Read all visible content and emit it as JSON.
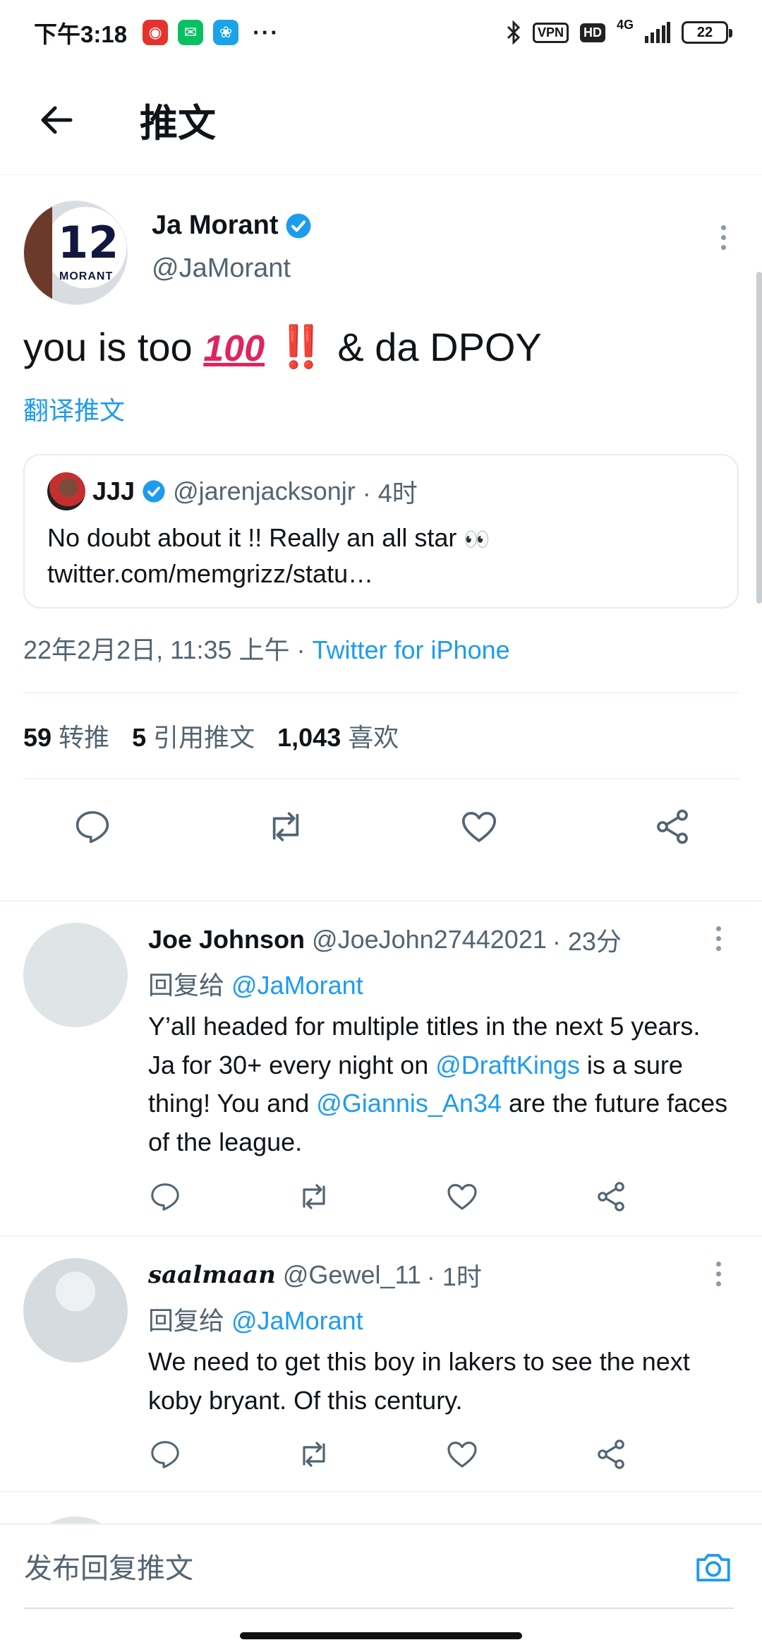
{
  "status_bar": {
    "time": "下午3:18",
    "dots": "···",
    "vpn": "VPN",
    "hd": "HD",
    "network": "4G",
    "battery": "22"
  },
  "header": {
    "title": "推文"
  },
  "main_tweet": {
    "author_name": "Ja Morant",
    "author_handle": "@JaMorant",
    "avatar_number": "12",
    "avatar_jersey_name": "MORANT",
    "text_before": "you is too ",
    "emoji_100": "100",
    "emoji_bang": "‼️",
    "text_after": " & da DPOY",
    "translate": "翻译推文",
    "quote": {
      "name": "JJJ",
      "handle": "@jarenjacksonjr",
      "time": "· 4时",
      "text": "No doubt about it !! Really an all star ",
      "eyes": "👀",
      "link": "twitter.com/memgrizz/statu…"
    },
    "date": "22年2月2日, 11:35 上午 · ",
    "client": "Twitter for iPhone",
    "stats": {
      "retweets": "59",
      "retweets_label": "转推",
      "quotes": "5",
      "quotes_label": "引用推文",
      "likes": "1,043",
      "likes_label": "喜欢"
    }
  },
  "replies": [
    {
      "name": "Joe Johnson",
      "handle": "@JoeJohn27442021",
      "time": "· 23分",
      "reply_to_label": "回复给 ",
      "reply_to": "@JaMorant",
      "text_parts": {
        "a": "Y’all headed for multiple titles in the next 5 years. Ja for 30+ every night on ",
        "mention1": "@DraftKings",
        "b": " is a sure thing! You and ",
        "mention2": "@Giannis_An34",
        "c": " are the future faces of the league."
      }
    },
    {
      "name": "saalmaan",
      "handle": "@Gewel_11",
      "time": "· 1时",
      "reply_to_label": "回复给 ",
      "reply_to": "@JaMorant",
      "text": "We need to get this boy in lakers to see the next koby bryant. Of this century."
    }
  ],
  "compose": {
    "placeholder": "发布回复推文"
  },
  "colors": {
    "accent": "#1d9bf0",
    "secondary_text": "#536471",
    "divider": "#eff3f4"
  }
}
